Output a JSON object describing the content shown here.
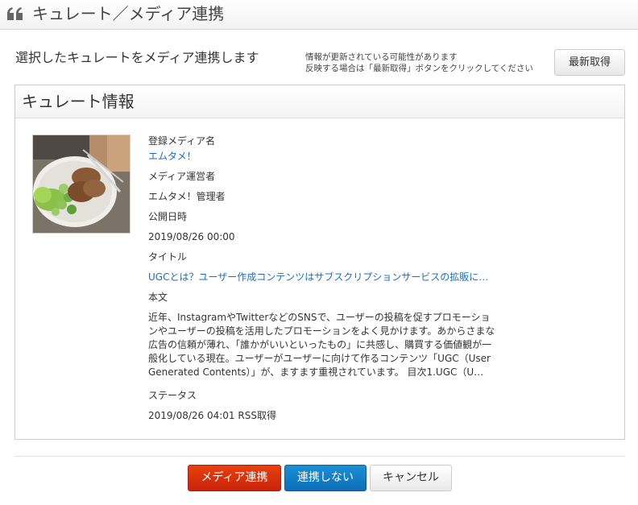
{
  "header": {
    "title": "キュレート／メディア連携",
    "icon": "quote-icon"
  },
  "intro": {
    "instruction": "選択したキュレートをメディア連携します",
    "notice_line1": "情報が更新されている可能性があります",
    "notice_line2": "反映する場合は「最新取得」ボタンをクリックしてください",
    "refresh_label": "最新取得"
  },
  "panel": {
    "title": "キュレート情報",
    "thumbnail_icon": "food-photo",
    "media_name_label": "登録メディア名",
    "media_name_value": "エムタメ！",
    "operator_label": "メディア運営者",
    "operator_value": "エムタメ！管理者",
    "published_label": "公開日時",
    "published_value": "2019/08/26 00:00",
    "title_label": "タイトル",
    "title_value": "UGCとは？ユーザー作成コンテンツはサブスクリプションサービスの拡販に…",
    "body_label": "本文",
    "body_value": "近年、InstagramやTwitterなどのSNSで、ユーザーの投稿を促すプロモーションやユーザーの投稿を活用したプロモーションをよく見かけます。あからさまな広告の信頼が薄れ、「誰かがいいといったもの」に共感し、購買する価値観が一般化している現在。ユーザーがユーザーに向けて作るコンテンツ「UGC（User Generated Contents）」が、ますます重視されています。 目次1.UGC（U…",
    "status_label": "ステータス",
    "status_value": "2019/08/26 04:01 RSS取得"
  },
  "actions": {
    "link_label": "メディア連携",
    "unlink_label": "連携しない",
    "cancel_label": "キャンセル"
  },
  "colors": {
    "link": "#1a6fb8",
    "primary_red": "#d8320c",
    "primary_blue": "#1480c8"
  }
}
